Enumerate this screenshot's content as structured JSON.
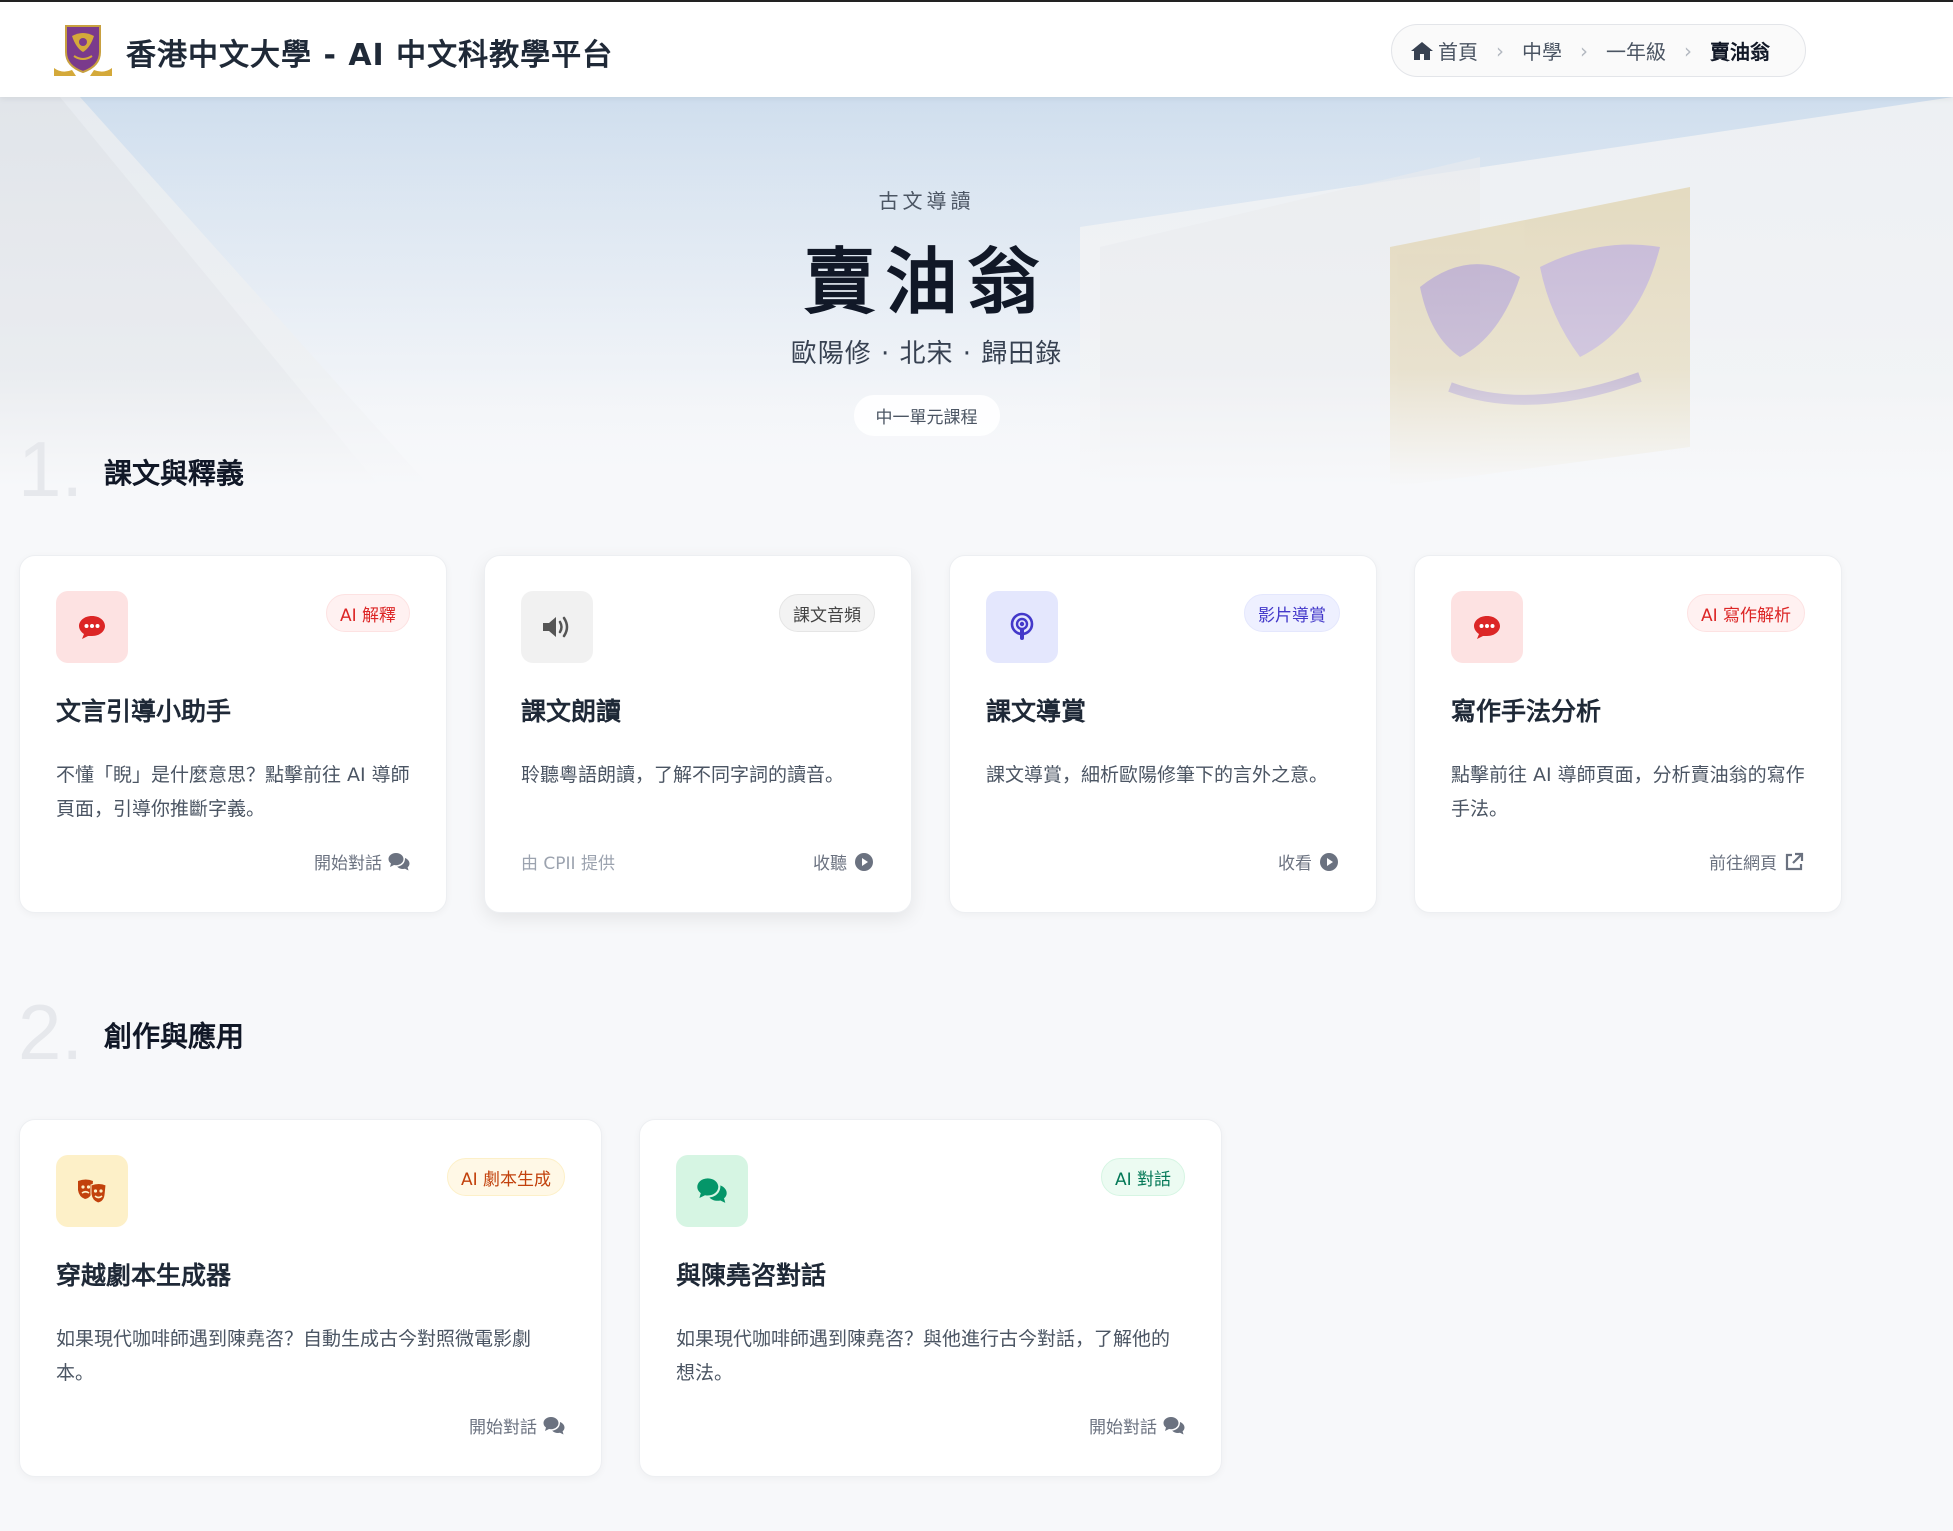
{
  "header": {
    "site_title": "香港中文大學 - AI 中文科教學平台",
    "breadcrumb": [
      "首頁",
      "中學",
      "一年級",
      "賣油翁"
    ]
  },
  "hero": {
    "subtitle": "古文導讀",
    "title": "賣油翁",
    "meta": "歐陽修 · 北宋 · 歸田錄",
    "tag": "中一單元課程"
  },
  "sections": [
    {
      "number": "1.",
      "title": "課文與釋義",
      "cards": [
        {
          "icon": "comment-dots-icon",
          "badge": "AI 解釋",
          "title": "文言引導小助手",
          "desc": "不懂「睨」是什麼意思？點擊前往 AI 導師頁面，引導你推斷字義。",
          "foot_left": "",
          "foot_right": "開始對話"
        },
        {
          "icon": "volume-icon",
          "badge": "課文音頻",
          "title": "課文朗讀",
          "desc": "聆聽粵語朗讀，了解不同字詞的讀音。",
          "foot_left": "由 CPII 提供",
          "foot_right": "收聽"
        },
        {
          "icon": "podcast-icon",
          "badge": "影片導賞",
          "title": "課文導賞",
          "desc": "課文導賞，細析歐陽修筆下的言外之意。",
          "foot_left": "",
          "foot_right": "收看"
        },
        {
          "icon": "comment-dots-icon",
          "badge": "AI 寫作解析",
          "title": "寫作手法分析",
          "desc": "點擊前往 AI 導師頁面，分析賣油翁的寫作手法。",
          "foot_left": "",
          "foot_right": "前往網頁"
        }
      ]
    },
    {
      "number": "2.",
      "title": "創作與應用",
      "cards": [
        {
          "icon": "theater-masks-icon",
          "badge": "AI 劇本生成",
          "title": "穿越劇本生成器",
          "desc": "如果現代咖啡師遇到陳堯咨？自動生成古今對照微電影劇本。",
          "foot_left": "",
          "foot_right": "開始對話"
        },
        {
          "icon": "comments-icon",
          "badge": "AI 對話",
          "title": "與陳堯咨對話",
          "desc": "如果現代咖啡師遇到陳堯咨？與他進行古今對話，了解他的想法。",
          "foot_left": "",
          "foot_right": "開始對話"
        }
      ]
    }
  ],
  "colors": {
    "red_bg": "#fde2e2",
    "red_fg": "#dc2626",
    "gray_bg": "#f1f1f1",
    "gray_fg": "#4b4b4b",
    "indigo_bg": "#e4e7fd",
    "indigo_fg": "#4338ca",
    "amber_bg": "#fdf0c8",
    "amber_fg": "#c2410c",
    "green_bg": "#d6f5e3",
    "green_fg": "#059669"
  }
}
